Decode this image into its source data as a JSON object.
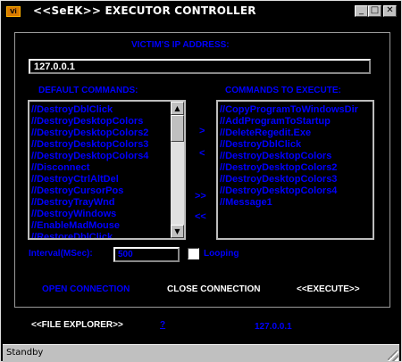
{
  "window": {
    "title": "<<SeEK>> EXECUTOR CONTROLLER",
    "app_icon_text": "Vi"
  },
  "labels": {
    "victim_ip": "VICTIM'S IP ADDRESS:",
    "default_commands": "DEFAULT COMMANDS:",
    "commands_to_execute": "COMMANDS TO EXECUTE:",
    "interval": "Interval(MSec):",
    "looping": "Looping"
  },
  "ip_field": {
    "value": "127.0.0.1"
  },
  "interval_field": {
    "value": "500"
  },
  "looping_checked": false,
  "default_commands": [
    "//DestroyDblClick",
    "//DestroyDesktopColors",
    "//DestroyDesktopColors2",
    "//DestroyDesktopColors3",
    "//DestroyDesktopColors4",
    "//Disconnect",
    "//DestroyCtrlAltDel",
    "//DestroyCursorPos",
    "//DestroyTrayWnd",
    "//DestroyWindows",
    "//EnableMadMouse",
    "//RestoreDblClick"
  ],
  "commands_to_execute": [
    "//CopyProgramToWindowsDir",
    "//AddProgramToStartup",
    "//DeleteRegedit.Exe",
    "//DestroyDblClick",
    "//DestroyDesktopColors",
    "//DestroyDesktopColors2",
    "//DestroyDesktopColors3",
    "//DestroyDesktopColors4",
    "//Message1"
  ],
  "arrows": {
    "move_right": ">",
    "move_left": "<",
    "move_all_right": ">>",
    "move_all_left": "<<"
  },
  "actions": {
    "open_connection": "OPEN CONNECTION",
    "close_connection": "CLOSE CONNECTION",
    "execute": "<<EXECUTE>>",
    "file_explorer": "<<FILE EXPLORER>>",
    "help": "?",
    "connected_ip": "127.0.0.1"
  },
  "status": {
    "text": "Standby"
  },
  "colors": {
    "accent": "#0000ff",
    "background": "#000000",
    "chrome": "#c0c0c0"
  }
}
